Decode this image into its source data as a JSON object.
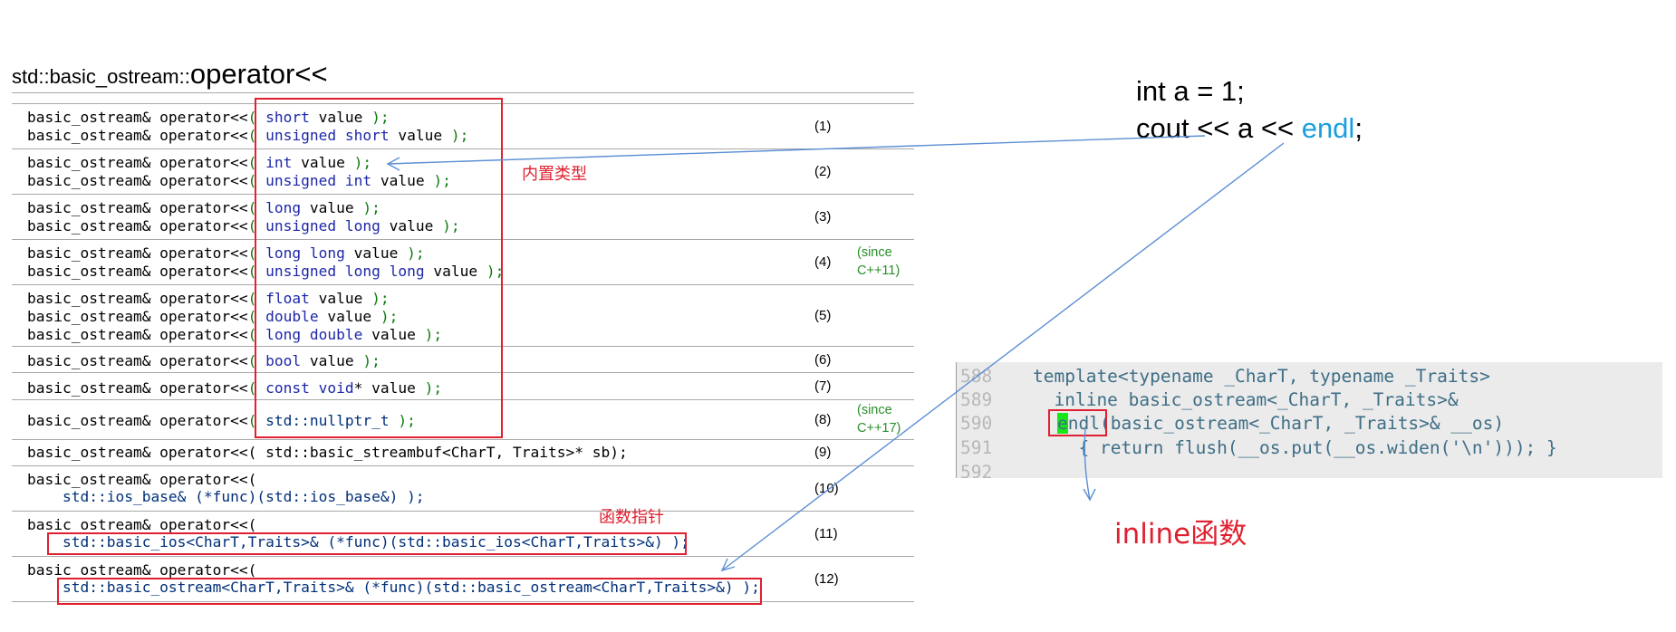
{
  "title": {
    "namespace": "std::basic_ostream::",
    "operator": "operator<<"
  },
  "prefix": "basic_ostream& operator<<",
  "rows": [
    {
      "tokens": [
        [
          "kw",
          "short"
        ],
        [
          "",
          "value"
        ]
      ]
    },
    {
      "tokens": [
        [
          "kw",
          "unsigned short"
        ],
        [
          "",
          "value"
        ]
      ]
    },
    {
      "tokens": [
        [
          "kw",
          "int"
        ],
        [
          "",
          "value"
        ]
      ]
    },
    {
      "tokens": [
        [
          "kw",
          "unsigned int"
        ],
        [
          "",
          "value"
        ]
      ]
    },
    {
      "tokens": [
        [
          "kw",
          "long"
        ],
        [
          "",
          "value"
        ]
      ]
    },
    {
      "tokens": [
        [
          "kw",
          "unsigned long"
        ],
        [
          "",
          "value"
        ]
      ]
    },
    {
      "tokens": [
        [
          "kw",
          "long long"
        ],
        [
          "",
          "value"
        ]
      ]
    },
    {
      "tokens": [
        [
          "kw",
          "unsigned long long"
        ],
        [
          "",
          "value"
        ]
      ]
    },
    {
      "tokens": [
        [
          "kw",
          "float"
        ],
        [
          "",
          "value"
        ]
      ]
    },
    {
      "tokens": [
        [
          "kw",
          "double"
        ],
        [
          "",
          "value"
        ]
      ]
    },
    {
      "tokens": [
        [
          "kw",
          "long double"
        ],
        [
          "",
          "value"
        ]
      ]
    },
    {
      "tokens": [
        [
          "kw",
          "bool"
        ],
        [
          "",
          "value"
        ]
      ]
    },
    {
      "tokens": [
        [
          "kw",
          "const void"
        ],
        [
          "",
          "* value"
        ]
      ]
    },
    {
      "tokens": [
        [
          "ty",
          "std::nullptr_t"
        ]
      ]
    }
  ],
  "lines": {
    "streambuf": "basic_ostream& operator<<( std::basic_streambuf<CharT, Traits>* sb);",
    "iosbase_head": "basic_ostream& operator<<(",
    "iosbase_body": "    std::ios_base& (*func)(std::ios_base&) );",
    "basicios_head": "basic_ostream& operator<<(",
    "basicios_body": "    std::basic_ios<CharT,Traits>& (*func)(std::basic_ios<CharT,Traits>&) );",
    "ostream_head": "basic_ostream& operator<<(",
    "ostream_body": "    std::basic_ostream<CharT,Traits>& (*func)(std::basic_ostream<CharT,Traits>&) );"
  },
  "numbers": [
    "(1)",
    "(2)",
    "(3)",
    "(4)",
    "(5)",
    "(6)",
    "(7)",
    "(8)",
    "(9)",
    "(10)",
    "(11)",
    "(12)"
  ],
  "since": {
    "c11a": "(since",
    "c11b": "C++11)",
    "c17a": "(since",
    "c17b": "C++17)"
  },
  "annotations": {
    "builtin": "内置类型",
    "funcptr": "函数指针",
    "inline": "inline函数"
  },
  "example": {
    "line1": "int a = 1;",
    "line2_pre": "cout << a << ",
    "line2_endl": "endl",
    "line2_post": ";"
  },
  "code": {
    "line_numbers": [
      "588",
      "589",
      "590",
      "591",
      "592"
    ],
    "l588": "template<typename _CharT, typename _Traits>",
    "l589": "  inline basic_ostream<_CharT, _Traits>&",
    "l590_e": "e",
    "l590_rest": "ndl(basic_ostream<_CharT, _Traits>& __os)",
    "l591": "  { return flush(__os.put(__os.widen('\\n'))); }"
  },
  "colors": {
    "highlight": "#e02030",
    "keyword": "#1d27a8",
    "punct": "#0d7a0d",
    "endl": "#1aa0dc",
    "code": "#3e6e86"
  }
}
